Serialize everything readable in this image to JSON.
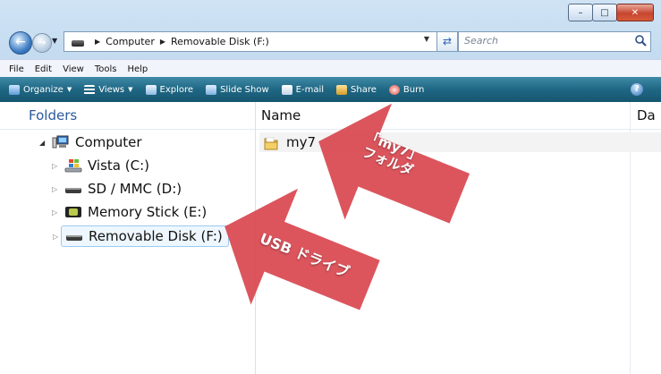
{
  "address_bar": {
    "crumbs": [
      "Computer",
      "Removable Disk (F:)"
    ]
  },
  "search": {
    "placeholder": "Search"
  },
  "menu": [
    "File",
    "Edit",
    "View",
    "Tools",
    "Help"
  ],
  "commands": [
    {
      "label": "Organize",
      "icon": "organize-icon",
      "dropdown": true
    },
    {
      "label": "Views",
      "icon": "views-icon",
      "dropdown": true
    },
    {
      "label": "Explore",
      "icon": "explore-icon",
      "dropdown": false
    },
    {
      "label": "Slide Show",
      "icon": "slideshow-icon",
      "dropdown": false
    },
    {
      "label": "E-mail",
      "icon": "email-icon",
      "dropdown": false
    },
    {
      "label": "Share",
      "icon": "share-icon",
      "dropdown": false
    },
    {
      "label": "Burn",
      "icon": "burn-icon",
      "dropdown": false
    }
  ],
  "nav_pane": {
    "header": "Folders",
    "items": [
      {
        "label": "Computer",
        "icon": "computer-icon"
      },
      {
        "label": "Vista (C:)",
        "icon": "windows-drive-icon"
      },
      {
        "label": "SD / MMC (D:)",
        "icon": "card-drive-icon"
      },
      {
        "label": "Memory Stick (E:)",
        "icon": "memory-stick-icon"
      },
      {
        "label": "Removable Disk (F:)",
        "icon": "removable-drive-icon",
        "selected": true
      }
    ]
  },
  "list_pane": {
    "columns": [
      "Name",
      "Da"
    ],
    "files": [
      {
        "name": "my7",
        "icon": "folder-icon"
      }
    ]
  },
  "annotations": {
    "folder_callout": [
      "「my7」",
      "フォルダ"
    ],
    "usb_callout": "USB ドライブ"
  },
  "colors": {
    "callout_red": "#d9464f",
    "command_bar": "#1f6784",
    "nav_header": "#2b5a9c"
  }
}
